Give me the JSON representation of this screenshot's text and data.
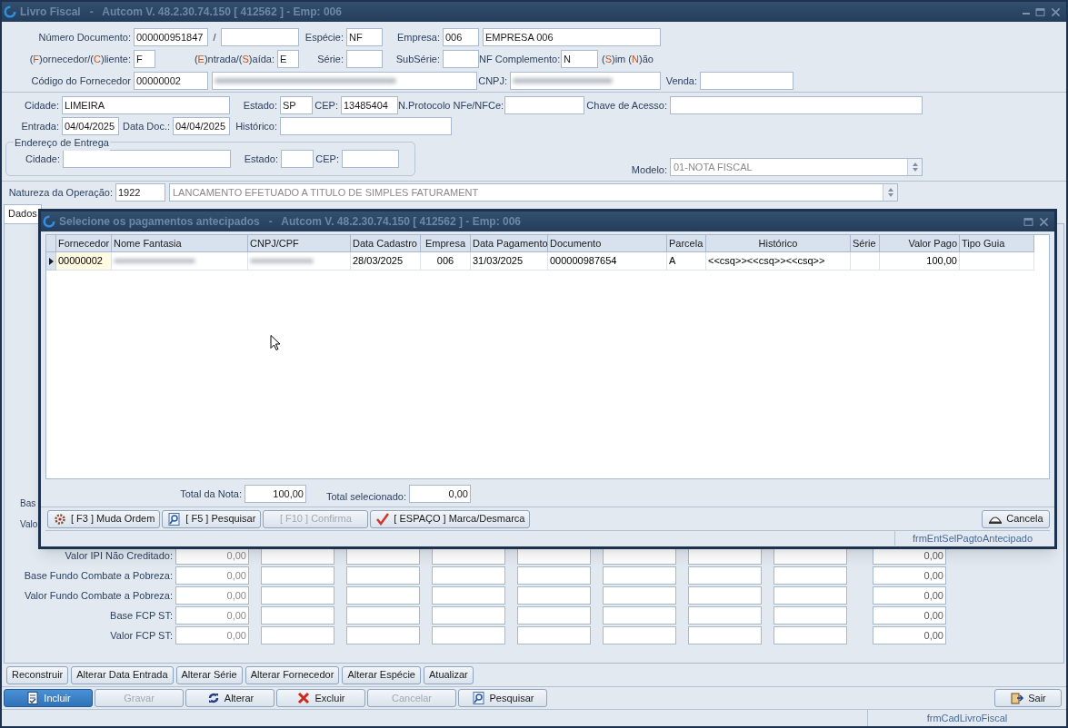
{
  "window": {
    "title": "Livro Fiscal   -   Autcom V. 48.2.30.74.150 [ 412562 ] - Emp: 006"
  },
  "header": {
    "numero_documento": {
      "label": "Número Documento:",
      "value": "000000951847"
    },
    "separator": "/",
    "especie": {
      "label": "Espécie:",
      "value": "NF"
    },
    "empresa": {
      "label": "Empresa:",
      "code": "006",
      "name": "EMPRESA 006"
    },
    "fornecedor_cliente": {
      "label": "(F)ornecedor/(C)liente:",
      "value": "F"
    },
    "entrada_saida": {
      "label": "(E)ntrada/(S)aída:",
      "value": "E"
    },
    "serie": {
      "label": "Série:"
    },
    "subserie": {
      "label": "SubSérie:"
    },
    "nf_complemento": {
      "label": "NF Complemento:",
      "value": "N",
      "hint": "(S)im (N)ão"
    },
    "codigo_fornecedor": {
      "label": "Código do Fornecedor",
      "value": "00000002"
    },
    "cnpj": {
      "label": "CNPJ:"
    },
    "venda": {
      "label": "Venda:"
    }
  },
  "address": {
    "cidade": {
      "label": "Cidade:",
      "value": "LIMEIRA"
    },
    "estado": {
      "label": "Estado:",
      "value": "SP"
    },
    "cep": {
      "label": "CEP:",
      "value": "13485404"
    },
    "protocolo": {
      "label": "N.Protocolo NFe/NFCe:"
    },
    "chave": {
      "label": "Chave de Acesso:"
    },
    "entrada": {
      "label": "Entrada:",
      "value": "04/04/2025"
    },
    "data_doc": {
      "label": "Data Doc.:",
      "value": "04/04/2025"
    },
    "historico": {
      "label": "Histórico:"
    }
  },
  "delivery": {
    "title": "Endereço de Entrega",
    "cidade": {
      "label": "Cidade:"
    },
    "estado": {
      "label": "Estado:"
    },
    "cep": {
      "label": "CEP:"
    }
  },
  "modelo": {
    "label": "Modelo:",
    "value": "01-NOTA FISCAL"
  },
  "natureza": {
    "label": "Natureza da Operação:",
    "code": "1922",
    "description": "LANCAMENTO EFETUADO A TITULO DE SIMPLES FATURAMENT"
  },
  "tabs": [
    {
      "label": "Dados",
      "selected": true
    }
  ],
  "partial_labels": [
    "Bas",
    "Valo"
  ],
  "tax_rows": [
    {
      "label": "Valor IPI Não Creditado:",
      "first": "0,00",
      "last": "0,00"
    },
    {
      "label": "Base Fundo Combate a Pobreza:",
      "first": "0,00",
      "last": "0,00"
    },
    {
      "label": "Valor Fundo Combate a Pobreza:",
      "first": "0,00",
      "last": "0,00"
    },
    {
      "label": "Base FCP ST:",
      "first": "0,00",
      "last": "0,00"
    },
    {
      "label": "Valor FCP ST:",
      "first": "0,00",
      "last": "0,00"
    }
  ],
  "action_buttons": [
    "Reconstruir",
    "Alterar Data Entrada",
    "Alterar Série",
    "Alterar Fornecedor",
    "Alterar Espécie",
    "Atualizar"
  ],
  "toolbar": [
    {
      "label": "Incluir",
      "disabled": false,
      "focused": true
    },
    {
      "label": "Gravar",
      "disabled": true,
      "focused": false
    },
    {
      "label": "Alterar",
      "disabled": false,
      "focused": false
    },
    {
      "label": "Excluir",
      "disabled": false,
      "focused": false
    },
    {
      "label": "Cancelar",
      "disabled": true,
      "focused": false
    },
    {
      "label": "Pesquisar",
      "disabled": false,
      "focused": false
    }
  ],
  "exit_button": {
    "label": "Sair"
  },
  "status_bar": {
    "form_name": "frmCadLivroFiscal"
  },
  "dialog": {
    "title": "Selecione os pagamentos antecipados   -   Autcom V. 48.2.30.74.150 [ 412562 ] - Emp: 006",
    "table": {
      "columns": [
        "Fornecedor",
        "Nome Fantasia",
        "CNPJ/CPF",
        "Data Cadastro",
        "Empresa",
        "Data Pagamento",
        "Documento",
        "Parcela",
        "Histórico",
        "Série",
        "Valor Pago",
        "Tipo Guia"
      ],
      "rows": [
        {
          "selected": true,
          "fornecedor": "00000002",
          "data_cadastro": "28/03/2025",
          "empresa": "006",
          "data_pagamento": "31/03/2025",
          "documento": "000000987654",
          "parcela": "A",
          "historico": "<<csq>><<csq>><<csq>>",
          "valor_pago": "100,00"
        }
      ]
    },
    "totals": {
      "total_nota": {
        "label": "Total da Nota:",
        "value": "100,00"
      },
      "total_selecionado": {
        "label": "Total selecionado:",
        "value": "0,00"
      }
    },
    "buttons": [
      {
        "label": "[ F3 ] Muda Ordem",
        "disabled": false
      },
      {
        "label": "[ F5 ] Pesquisar",
        "disabled": false
      },
      {
        "label": "[ F10 ] Confirma",
        "disabled": true
      },
      {
        "label": "[ ESPAÇO ] Marca/Desmarca",
        "disabled": false
      }
    ],
    "cancel_button": "Cancela",
    "status_bar": "frmEntSelPagtoAntecipado"
  }
}
